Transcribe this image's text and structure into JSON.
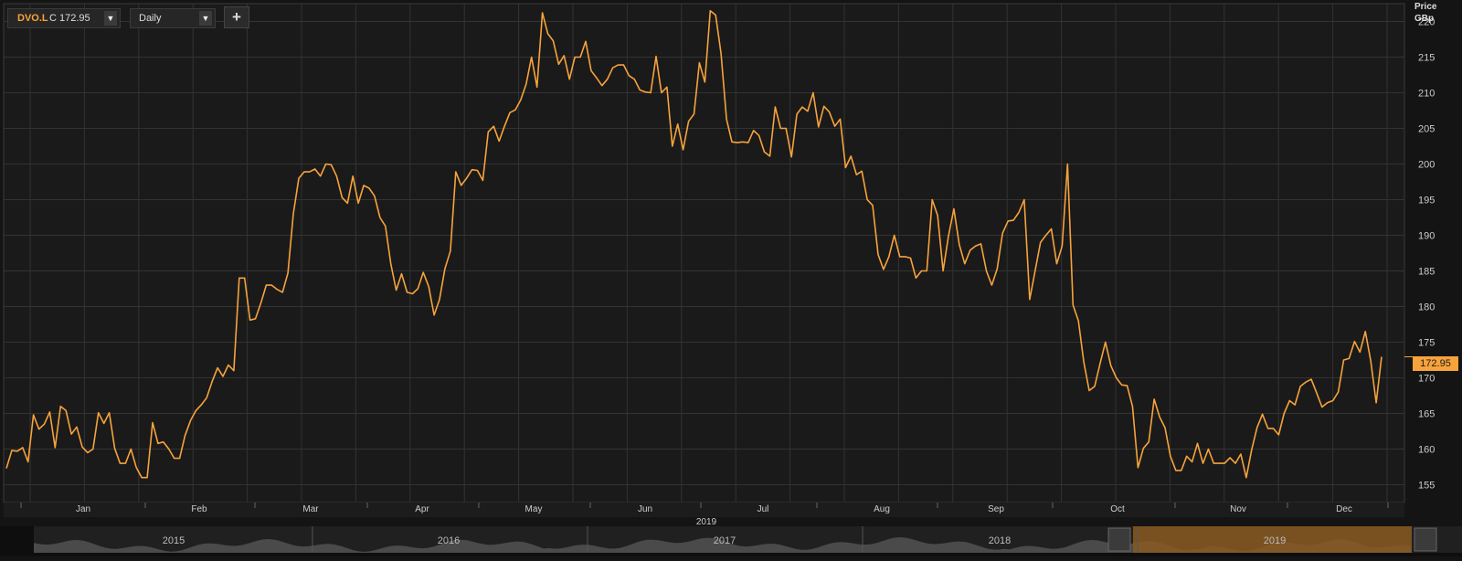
{
  "header": {
    "ticker": "DVO.L",
    "close_label": "C",
    "close_value": "172.95",
    "interval": "Daily",
    "add_symbol": "+"
  },
  "axis": {
    "price_label": "Price",
    "unit_label": "GBp",
    "year_label": "2019"
  },
  "last_price_badge": "172.95",
  "navigator": {
    "years": [
      "2015",
      "2016",
      "2017",
      "2018",
      "2019"
    ],
    "selected_year": "2019"
  },
  "colors": {
    "background": "#1a1a1a",
    "grid": "#333333",
    "line": "#f7a33c",
    "navigator_selection": "#8a5a22"
  },
  "chart_data": {
    "type": "line",
    "title": "",
    "xlabel": "2019",
    "ylabel": "Price GBp",
    "ylim": [
      152.5,
      222.5
    ],
    "yticks": [
      155,
      160,
      165,
      170,
      175,
      180,
      185,
      190,
      195,
      200,
      205,
      210,
      215,
      220
    ],
    "month_labels": [
      "Jan",
      "Feb",
      "Mar",
      "Apr",
      "May",
      "Jun",
      "Jul",
      "Aug",
      "Sep",
      "Oct",
      "Nov",
      "Dec"
    ],
    "grid": true,
    "series": [
      {
        "values": [
          157.3,
          159.8,
          159.7,
          160.2,
          158.2,
          164.8,
          162.8,
          163.5,
          165.2,
          160.2,
          166,
          165.4,
          162.1,
          163.1,
          160.3,
          159.5,
          160,
          165.1,
          163.6,
          165.1,
          160.1,
          158,
          158,
          160,
          157.4,
          156,
          156,
          163.7,
          160.8,
          161,
          160,
          158.7,
          158.7,
          161.9,
          164,
          165.4,
          166.2,
          167.2,
          169.5,
          171.4,
          170.2,
          171.8,
          171,
          184,
          184,
          178.1,
          178.3,
          180.5,
          183,
          183,
          182.4,
          182,
          184.7,
          193,
          198,
          198.9,
          198.9,
          199.3,
          198.3,
          200,
          199.9,
          198.3,
          195.3,
          194.5,
          198.3,
          194.5,
          197,
          196.6,
          195.5,
          192.5,
          191.3,
          186,
          182.3,
          184.6,
          182,
          181.8,
          182.5,
          184.8,
          182.8,
          178.8,
          181,
          185.3,
          187.8,
          198.9,
          197,
          198,
          199.2,
          199.1,
          197.7,
          204.5,
          205.3,
          203.2,
          205.3,
          207.2,
          207.6,
          209,
          211.2,
          215,
          210.8,
          221.2,
          218.3,
          217.3,
          214,
          215.2,
          211.9,
          215,
          215,
          217.2,
          213.1,
          212.1,
          211,
          211.9,
          213.5,
          213.9,
          213.9,
          212.4,
          211.9,
          210.4,
          210.1,
          210,
          215.1,
          210,
          210.8,
          202.5,
          205.6,
          202,
          206,
          207,
          214.2,
          211.5,
          221.5,
          220.9,
          215.5,
          206.3,
          203.1,
          203,
          203.1,
          203,
          204.7,
          204,
          201.7,
          201.1,
          208,
          205,
          205,
          201,
          207,
          208,
          207.4,
          210,
          205.2,
          208.1,
          207.3,
          205.3,
          206.3,
          199.5,
          201.1,
          198.5,
          199,
          195,
          194.2,
          187.3,
          185.2,
          187,
          190,
          187,
          187,
          186.8,
          184,
          185,
          185,
          195,
          192.8,
          185,
          189.9,
          193.7,
          188.7,
          186,
          187.9,
          188.5,
          188.8,
          185,
          183,
          185.3,
          190.3,
          192,
          192.1,
          193.2,
          195,
          181,
          185,
          189,
          190,
          190.9,
          186,
          188.5,
          200,
          180.2,
          178,
          172.2,
          168.2,
          168.8,
          172,
          175,
          171.7,
          170,
          169,
          168.9,
          166,
          157.4,
          160.1,
          161,
          167,
          164.5,
          163,
          159,
          157,
          157,
          159,
          158.2,
          160.8,
          158,
          160,
          158,
          158,
          158,
          158.8,
          158,
          159.3,
          156,
          159.9,
          163,
          164.9,
          162.9,
          162.9,
          162,
          165,
          166.8,
          166.2,
          168.8,
          169.4,
          169.8,
          167.9,
          165.9,
          166.5,
          166.8,
          168,
          172.5,
          172.7,
          175.1,
          173.6,
          176.5,
          172.4,
          166.5,
          172.95
        ]
      }
    ]
  }
}
